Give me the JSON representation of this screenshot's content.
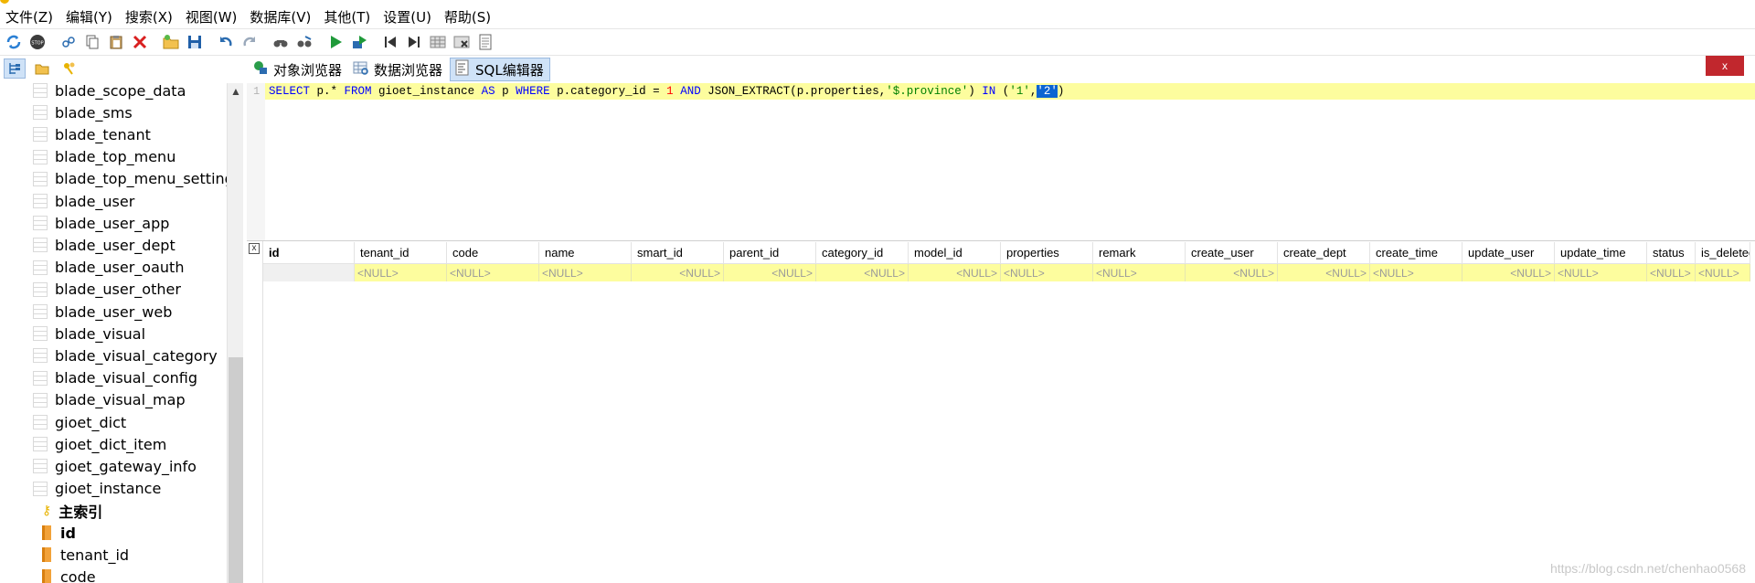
{
  "menu": [
    "文件(Z)",
    "编辑(Y)",
    "搜索(X)",
    "视图(W)",
    "数据库(V)",
    "其他(T)",
    "设置(U)",
    "帮助(S)"
  ],
  "toolbar": {
    "icons": [
      "refresh-icon",
      "stop-icon",
      "link-icon",
      "copy-icon",
      "paste-icon",
      "delete-icon",
      "open-icon",
      "save-icon",
      "undo-icon",
      "redo-icon",
      "find-icon",
      "replace-icon",
      "run-icon",
      "run-selection-icon",
      "first-icon",
      "last-icon",
      "grid-icon",
      "grid-remove-icon",
      "notes-icon"
    ],
    "stop_label": "STOP"
  },
  "tabs": [
    {
      "label": "对象浏览器",
      "icon": "object-browser-icon"
    },
    {
      "label": "数据浏览器",
      "icon": "data-browser-icon"
    },
    {
      "label": "SQL编辑器",
      "icon": "sql-editor-icon",
      "active": true
    }
  ],
  "close_label": "x",
  "tree": {
    "tables": [
      "blade_scope_data",
      "blade_sms",
      "blade_tenant",
      "blade_top_menu",
      "blade_top_menu_setting",
      "blade_user",
      "blade_user_app",
      "blade_user_dept",
      "blade_user_oauth",
      "blade_user_other",
      "blade_user_web",
      "blade_visual",
      "blade_visual_category",
      "blade_visual_config",
      "blade_visual_map",
      "gioet_dict",
      "gioet_dict_item",
      "gioet_gateway_info",
      "gioet_instance"
    ],
    "primary_key_label": "主索引",
    "columns": [
      "id",
      "tenant_id",
      "code"
    ]
  },
  "editor": {
    "line_number": "1",
    "sql": {
      "t1": "SELECT",
      "t2": " p.* ",
      "t3": "FROM",
      "t4": " gioet_instance ",
      "t5": "AS",
      "t6": " p ",
      "t7": "WHERE",
      "t8": " p.category_id = ",
      "t9": "1",
      "t10": " ",
      "t11": "AND",
      "t12": " JSON_EXTRACT(p.properties,",
      "t13": "'$.province'",
      "t14": ") ",
      "t15": "IN",
      "t16": " (",
      "t17": "'1'",
      "t18": ",",
      "t19": "'2'",
      "t20": ")"
    }
  },
  "result": {
    "close_label": "x",
    "columns": [
      "id",
      "tenant_id",
      "code",
      "name",
      "smart_id",
      "parent_id",
      "category_id",
      "model_id",
      "properties",
      "remark",
      "create_user",
      "create_dept",
      "create_time",
      "update_user",
      "update_time",
      "status",
      "is_deleted"
    ],
    "row": [
      "",
      "<NULL>",
      "<NULL>",
      "<NULL>",
      "<NULL>",
      "<NULL>",
      "<NULL>",
      "<NULL>",
      "<NULL>",
      "<NULL>",
      "<NULL>",
      "<NULL>",
      "<NULL>",
      "<NULL>",
      "<NULL>",
      "<NULL>",
      "<NULL>"
    ]
  },
  "watermark": "https://blog.csdn.net/chenhao0568"
}
